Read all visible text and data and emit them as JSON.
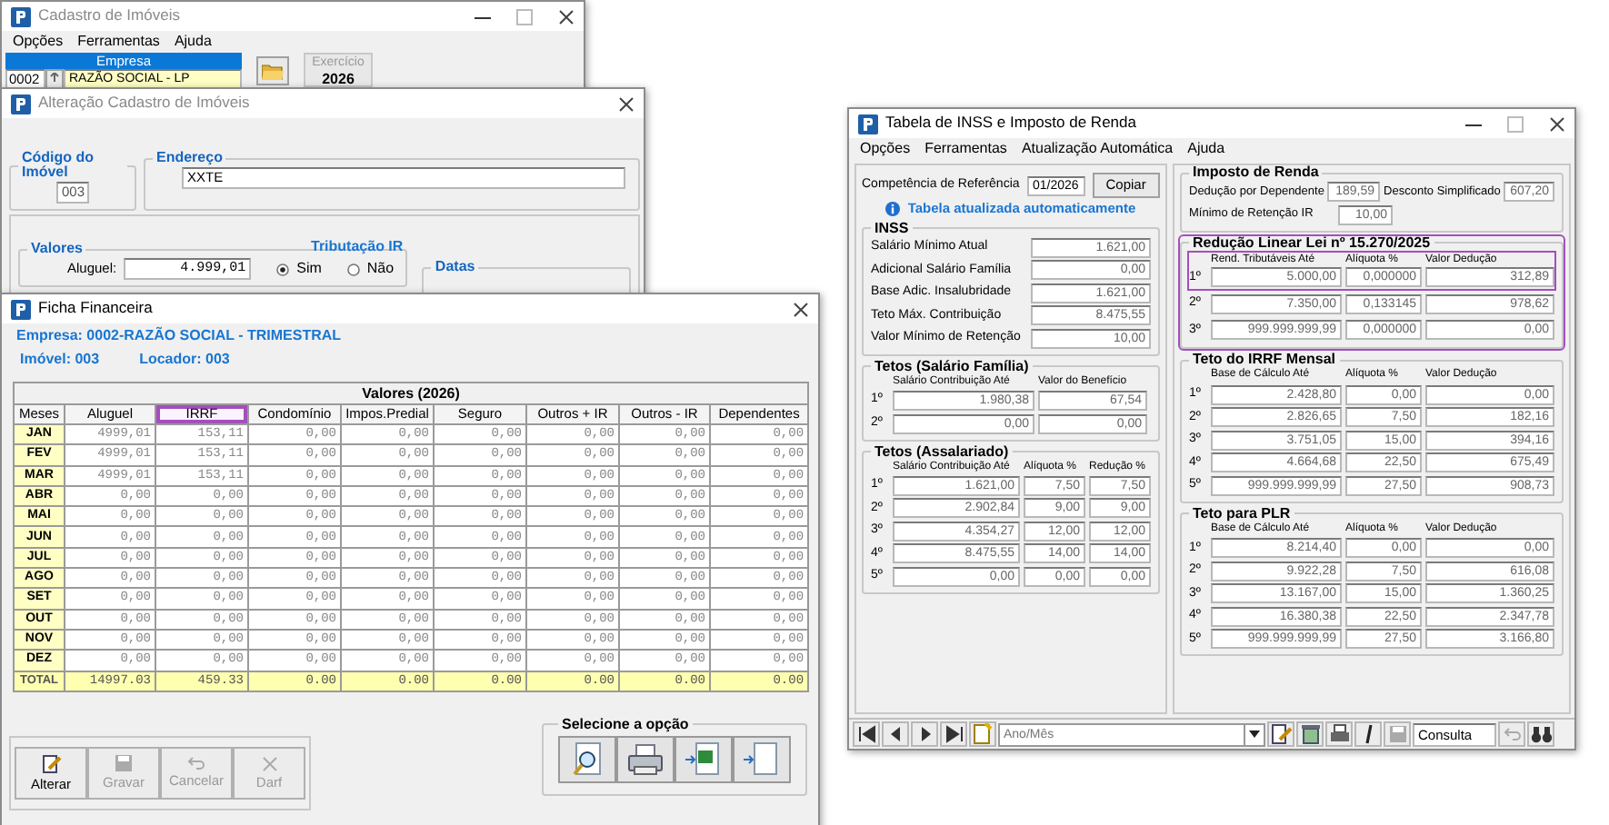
{
  "cadastro_window": {
    "title": "Cadastro de Imóveis",
    "active": false,
    "menu": [
      "Opções",
      "Ferramentas",
      "Ajuda"
    ],
    "empresa": {
      "label": "Empresa",
      "code": "0002",
      "name": "RAZÃO SOCIAL - LP"
    },
    "exercicio": {
      "label": "Exercício",
      "value": "2026"
    }
  },
  "alteracao_window": {
    "title": "Alteração Cadastro de Imóveis",
    "active": false,
    "codigo": {
      "legend": "Código do Imóvel",
      "value": "003"
    },
    "endereco": {
      "legend": "Endereço",
      "value": "XXTE"
    },
    "valores": {
      "legend": "Valores",
      "label": "Aluguel:",
      "value": "4.999,01"
    },
    "tributacao": {
      "legend": "Tributação IR",
      "options": [
        {
          "label": "Sim",
          "selected": true
        },
        {
          "label": "Não",
          "selected": false
        }
      ]
    },
    "datas": {
      "legend": "Datas"
    }
  },
  "ficha_window": {
    "title": "Ficha Financeira",
    "active": true,
    "empresa": "Empresa: 0002-RAZÃO SOCIAL - TRIMESTRAL",
    "imovel": "Imóvel: 003",
    "locador": "Locador: 003",
    "table": {
      "title": "Valores (2026)",
      "columns": [
        {
          "label": "Meses",
          "highlighted": false
        },
        {
          "label": "Aluguel",
          "highlighted": false
        },
        {
          "label": "IRRF",
          "highlighted": true
        },
        {
          "label": "Condomínio",
          "highlighted": false
        },
        {
          "label": "Impos.Predial",
          "highlighted": false
        },
        {
          "label": "Seguro",
          "highlighted": false
        },
        {
          "label": "Outros + IR",
          "highlighted": false
        },
        {
          "label": "Outros - IR",
          "highlighted": false
        },
        {
          "label": "Dependentes",
          "highlighted": false
        }
      ],
      "rows": [
        {
          "month": "JAN",
          "values": [
            "4999,01",
            "153,11",
            "0,00",
            "0,00",
            "0,00",
            "0,00",
            "0,00",
            "0,00"
          ]
        },
        {
          "month": "FEV",
          "values": [
            "4999,01",
            "153,11",
            "0,00",
            "0,00",
            "0,00",
            "0,00",
            "0,00",
            "0,00"
          ]
        },
        {
          "month": "MAR",
          "values": [
            "4999,01",
            "153,11",
            "0,00",
            "0,00",
            "0,00",
            "0,00",
            "0,00",
            "0,00"
          ]
        },
        {
          "month": "ABR",
          "values": [
            "0,00",
            "0,00",
            "0,00",
            "0,00",
            "0,00",
            "0,00",
            "0,00",
            "0,00"
          ]
        },
        {
          "month": "MAI",
          "values": [
            "0,00",
            "0,00",
            "0,00",
            "0,00",
            "0,00",
            "0,00",
            "0,00",
            "0,00"
          ]
        },
        {
          "month": "JUN",
          "values": [
            "0,00",
            "0,00",
            "0,00",
            "0,00",
            "0,00",
            "0,00",
            "0,00",
            "0,00"
          ]
        },
        {
          "month": "JUL",
          "values": [
            "0,00",
            "0,00",
            "0,00",
            "0,00",
            "0,00",
            "0,00",
            "0,00",
            "0,00"
          ]
        },
        {
          "month": "AGO",
          "values": [
            "0,00",
            "0,00",
            "0,00",
            "0,00",
            "0,00",
            "0,00",
            "0,00",
            "0,00"
          ]
        },
        {
          "month": "SET",
          "values": [
            "0,00",
            "0,00",
            "0,00",
            "0,00",
            "0,00",
            "0,00",
            "0,00",
            "0,00"
          ]
        },
        {
          "month": "OUT",
          "values": [
            "0,00",
            "0,00",
            "0,00",
            "0,00",
            "0,00",
            "0,00",
            "0,00",
            "0,00"
          ]
        },
        {
          "month": "NOV",
          "values": [
            "0,00",
            "0,00",
            "0,00",
            "0,00",
            "0,00",
            "0,00",
            "0,00",
            "0,00"
          ]
        },
        {
          "month": "DEZ",
          "values": [
            "0,00",
            "0,00",
            "0,00",
            "0,00",
            "0,00",
            "0,00",
            "0,00",
            "0,00"
          ]
        }
      ],
      "total": {
        "label": "TOTAL",
        "values": [
          "14997.03",
          "459.33",
          "0.00",
          "0.00",
          "0.00",
          "0.00",
          "0.00",
          "0.00"
        ]
      }
    },
    "buttons": [
      {
        "label": "Alterar",
        "kind": "edit",
        "disabled": false
      },
      {
        "label": "Gravar",
        "kind": "save",
        "disabled": true
      },
      {
        "label": "Cancelar",
        "kind": "undo",
        "disabled": true
      },
      {
        "label": "Darf",
        "kind": "close",
        "disabled": true
      }
    ],
    "options": {
      "legend": "Selecione a opção"
    }
  },
  "inss_window": {
    "title": "Tabela de INSS e Imposto de Renda",
    "active": true,
    "menu": [
      "Opções",
      "Ferramentas",
      "Atualização Automática",
      "Ajuda"
    ],
    "competencia": {
      "label": "Competência de Referência",
      "value": "01/2026"
    },
    "copy_button": "Copiar",
    "info": "Tabela atualizada automaticamente",
    "inss": {
      "legend": "INSS",
      "fields": [
        {
          "label": "Salário Mínimo Atual",
          "value": "1.621,00"
        },
        {
          "label": "Adicional Salário Família",
          "value": "0,00"
        },
        {
          "label": "Base Adic. Insalubridade",
          "value": "1.621,00"
        },
        {
          "label": "Teto Máx. Contribuição",
          "value": "8.475,55"
        },
        {
          "label": "Valor Mínimo de Retenção",
          "value": "10,00"
        }
      ]
    },
    "salario_familia": {
      "legend": "Tetos (Salário Família)",
      "columns": [
        "Salário Contribuição Até",
        "Valor do Benefício"
      ],
      "rows": [
        {
          "ordinal": "1º",
          "values": [
            "1.980,38",
            "67,54"
          ]
        },
        {
          "ordinal": "2º",
          "values": [
            "0,00",
            "0,00"
          ]
        }
      ]
    },
    "assalariado": {
      "legend": "Tetos (Assalariado)",
      "columns": [
        "Salário Contribuição Até",
        "Alíquota %",
        "Redução %"
      ],
      "rows": [
        {
          "ordinal": "1º",
          "values": [
            "1.621,00",
            "7,50",
            "7,50"
          ]
        },
        {
          "ordinal": "2º",
          "values": [
            "2.902,84",
            "9,00",
            "9,00"
          ]
        },
        {
          "ordinal": "3º",
          "values": [
            "4.354,27",
            "12,00",
            "12,00"
          ]
        },
        {
          "ordinal": "4º",
          "values": [
            "8.475,55",
            "14,00",
            "14,00"
          ]
        },
        {
          "ordinal": "5º",
          "values": [
            "0,00",
            "0,00",
            "0,00"
          ]
        }
      ]
    },
    "imposto_renda": {
      "legend": "Imposto de Renda",
      "deducao": {
        "label": "Dedução por Dependente",
        "value": "189,59"
      },
      "desconto": {
        "label": "Desconto Simplificado",
        "value": "607,20"
      },
      "minimo": {
        "label": "Mínimo de Retenção IR",
        "value": "10,00"
      }
    },
    "reducao": {
      "legend": "Redução Linear Lei nº 15.270/2025",
      "highlighted": true,
      "columns": [
        "Rend. Tributáveis Até",
        "Alíquota %",
        "Valor Dedução"
      ],
      "rows": [
        {
          "ordinal": "1º",
          "highlighted": true,
          "values": [
            "5.000,00",
            "0,000000",
            "312,89"
          ]
        },
        {
          "ordinal": "2º",
          "highlighted": false,
          "values": [
            "7.350,00",
            "0,133145",
            "978,62"
          ]
        },
        {
          "ordinal": "3º",
          "highlighted": false,
          "values": [
            "999.999.999,99",
            "0,000000",
            "0,00"
          ]
        }
      ]
    },
    "irrf_mensal": {
      "legend": "Teto do IRRF Mensal",
      "columns": [
        "Base de Cálculo Até",
        "Alíquota %",
        "Valor Dedução"
      ],
      "rows": [
        {
          "ordinal": "1º",
          "values": [
            "2.428,80",
            "0,00",
            "0,00"
          ]
        },
        {
          "ordinal": "2º",
          "values": [
            "2.826,65",
            "7,50",
            "182,16"
          ]
        },
        {
          "ordinal": "3º",
          "values": [
            "3.751,05",
            "15,00",
            "394,16"
          ]
        },
        {
          "ordinal": "4º",
          "values": [
            "4.664,68",
            "22,50",
            "675,49"
          ]
        },
        {
          "ordinal": "5º",
          "values": [
            "999.999.999,99",
            "27,50",
            "908,73"
          ]
        }
      ]
    },
    "plr": {
      "legend": "Teto para PLR",
      "columns": [
        "Base de Cálculo Até",
        "Alíquota %",
        "Valor Dedução"
      ],
      "rows": [
        {
          "ordinal": "1º",
          "values": [
            "8.214,40",
            "0,00",
            "0,00"
          ]
        },
        {
          "ordinal": "2º",
          "values": [
            "9.922,28",
            "7,50",
            "616,08"
          ]
        },
        {
          "ordinal": "3º",
          "values": [
            "13.167,00",
            "15,00",
            "1.360,25"
          ]
        },
        {
          "ordinal": "4º",
          "values": [
            "16.380,38",
            "22,50",
            "2.347,78"
          ]
        },
        {
          "ordinal": "5º",
          "values": [
            "999.999.999,99",
            "27,50",
            "3.166,80"
          ]
        }
      ]
    },
    "toolbar": {
      "period_placeholder": "Ano/Mês",
      "mode": "Consulta"
    }
  }
}
